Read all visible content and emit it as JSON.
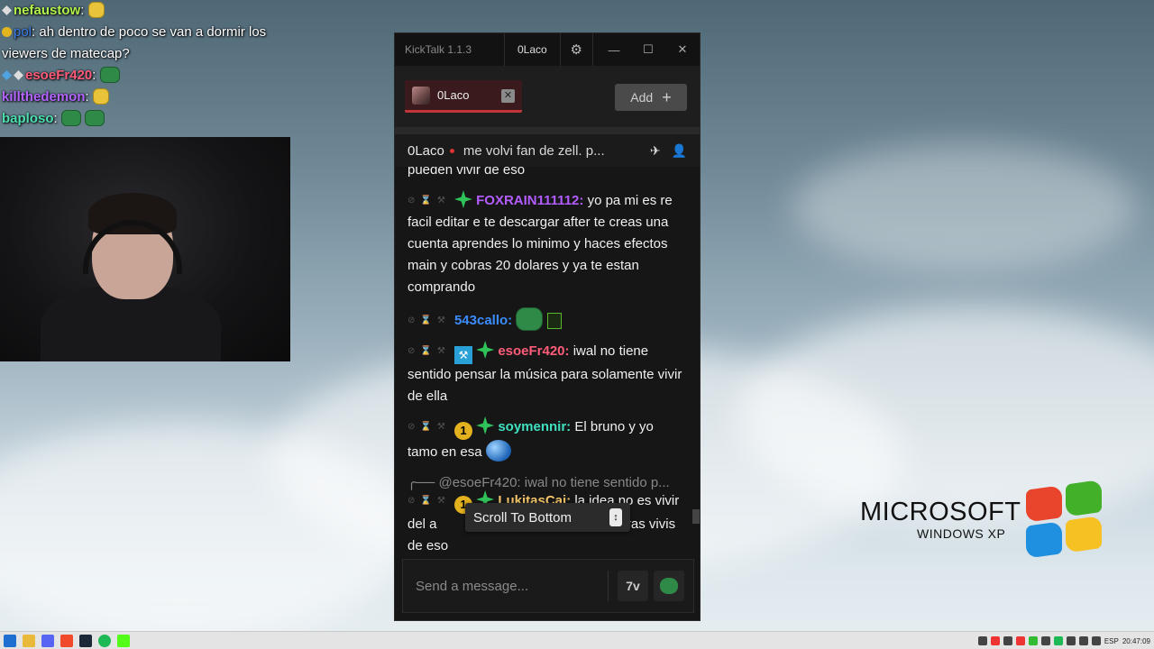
{
  "overlay_chat": {
    "lines": [
      {
        "user": "nefaustow",
        "user_color": "#b2f24c",
        "text": ""
      },
      {
        "user": "pol",
        "user_color": "#3c7eea",
        "text": ": ah dentro de poco se van a dormir los viewers de matecap?"
      },
      {
        "user": "esoeFr420",
        "user_color": "#ff5c7a",
        "text": ""
      },
      {
        "user": "killthedemon",
        "user_color": "#b464ff",
        "text": ""
      },
      {
        "user": "baploso",
        "user_color": "#4de0b0",
        "text": ""
      }
    ]
  },
  "kicktalk": {
    "title": "KickTalk 1.1.3",
    "user_tab": "0Laco",
    "window_buttons": {
      "minimize": "—",
      "maximize": "☐",
      "close": "✕"
    },
    "channel_tab": {
      "name": "0Laco",
      "close": "✕"
    },
    "add_button": "Add",
    "add_icon": "+",
    "header": {
      "channel": "0Laco",
      "pinned": "me volvi fan de zell. p..."
    },
    "messages": [
      {
        "user": "",
        "color": "",
        "text": "pueden vivir de eso"
      },
      {
        "user": "FOXRAIN111112:",
        "color": "#b35cff",
        "text": "yo pa mi es re facil editar e te descargar after te creas una cuenta aprendes lo minimo y haces efectos main y cobras 20 dolares y ya te estan comprando"
      },
      {
        "user": "543callo:",
        "color": "#3a8cff",
        "text": ""
      },
      {
        "user": "esoeFr420:",
        "color": "#ff5c7a",
        "text": "iwal no tiene sentido pensar la música para solamente vivir de ella"
      },
      {
        "user": "soymennir:",
        "color": "#3fe0c0",
        "text": "El bruno y yo tamo en esa"
      },
      {
        "reply": "@esoeFr420: iwal no tiene sentido p..."
      },
      {
        "user": "LukitasCai:",
        "color": "#f3c46a",
        "text": "la idea no es vivir del a",
        "text_end": "e gusta mientras vivis de eso"
      }
    ],
    "one_badge": "1",
    "scroll_to_bottom": "Scroll To Bottom",
    "scroll_arrow": "↕",
    "input": {
      "placeholder": "Send a message..."
    },
    "kick_emote_label": "7v"
  },
  "desktop_logo": {
    "line1": "MICROSOFT",
    "line2": "WINDOWS XP"
  },
  "taskbar": {
    "language": "ESP",
    "clock": "20:47:09"
  }
}
